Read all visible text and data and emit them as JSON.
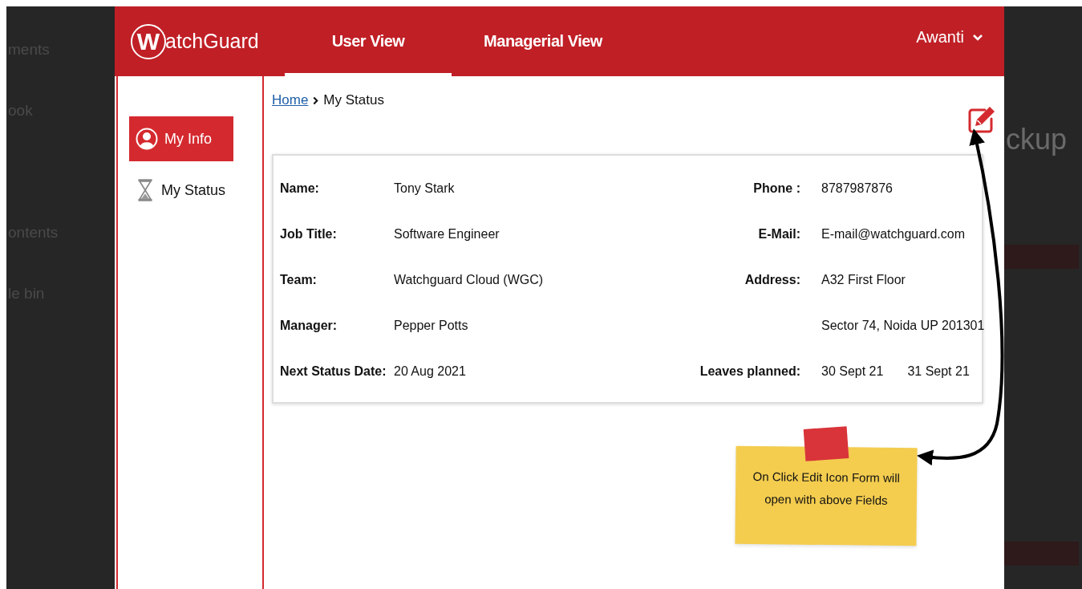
{
  "background": {
    "left_items": [
      "ments",
      "ook",
      "ontents",
      "le bin"
    ],
    "right_title": "ckup"
  },
  "header": {
    "logo": "WatchGuard",
    "tabs": [
      {
        "label": "User View",
        "selected": true
      },
      {
        "label": "Managerial View",
        "selected": false
      }
    ],
    "user": "Awanti"
  },
  "sidebar": {
    "items": [
      {
        "label": "My Info",
        "selected": true,
        "kind": "person"
      },
      {
        "label": "My Status",
        "selected": false,
        "kind": "hourglass"
      }
    ]
  },
  "breadcrumb": {
    "link": "Home",
    "current": "My Status"
  },
  "profile": {
    "rows": [
      {
        "label": "Name:",
        "value": "Tony Stark",
        "label_2": "Phone :",
        "values_2": [
          "8787987876"
        ]
      },
      {
        "label": "Job Title:",
        "value": "Software Engineer",
        "label_2": "E-Mail:",
        "values_2": [
          "E-mail@watchguard.com"
        ]
      },
      {
        "label": "Team:",
        "value": "Watchguard Cloud (WGC)",
        "label_2": "Address:",
        "values_2": [
          "A32 First Floor"
        ]
      },
      {
        "label": "Manager:",
        "value": "Pepper Potts",
        "values_2": [
          "Sector 74, Noida UP 201301"
        ]
      },
      {
        "label": "Next Status Date:",
        "value": "20 Aug 2021",
        "label_2": "Leaves planned:",
        "values_2": [
          "30 Sept 21",
          "31 Sept 21"
        ]
      }
    ]
  },
  "note": {
    "text": "On Click Edit Icon Form will open with above Fields"
  }
}
